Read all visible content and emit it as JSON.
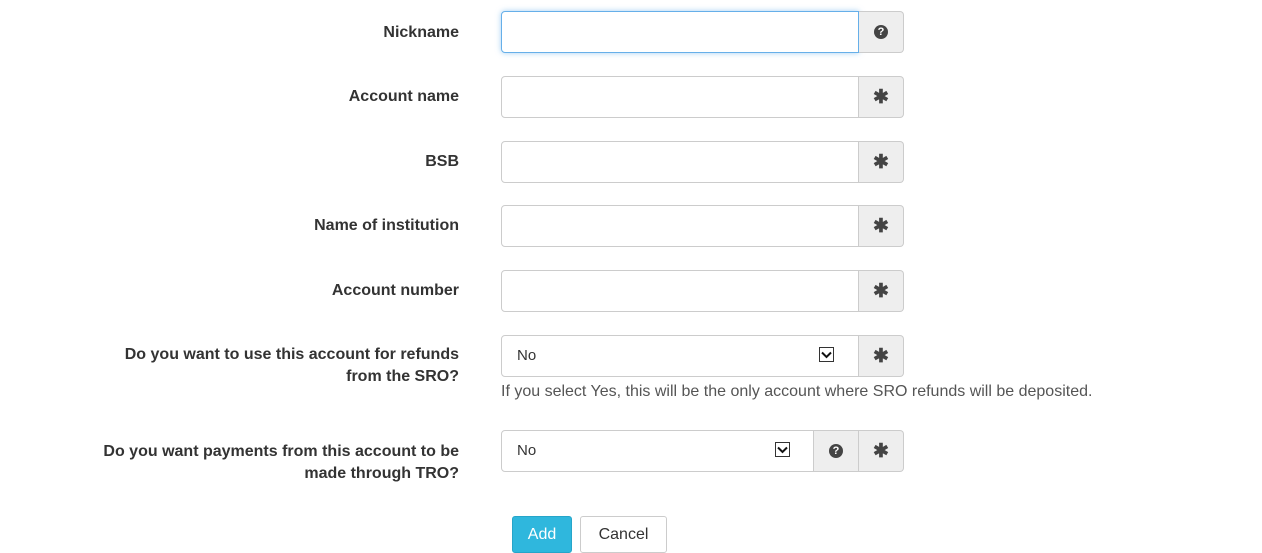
{
  "fields": {
    "nickname": {
      "label": "Nickname",
      "value": ""
    },
    "account_name": {
      "label": "Account name",
      "value": ""
    },
    "bsb": {
      "label": "BSB",
      "value": ""
    },
    "institution": {
      "label": "Name of institution",
      "value": ""
    },
    "account_number": {
      "label": "Account number",
      "value": ""
    },
    "refunds": {
      "label_line1": "Do you want to use this account for refunds",
      "label_line2": "from the SRO?",
      "value": "No",
      "hint": "If you select Yes, this will be the only account where SRO refunds will be deposited."
    },
    "payments": {
      "label_line1": "Do you want payments from this account to be",
      "label_line2": "made through TRO?",
      "value": "No"
    }
  },
  "icons": {
    "required": "asterisk-icon",
    "help": "question-circle-icon",
    "dropdown": "chevron-down-icon"
  },
  "glyphs": {
    "required": "✱",
    "help": "?"
  },
  "buttons": {
    "add": "Add",
    "cancel": "Cancel"
  },
  "colors": {
    "primary": "#2fb7dd",
    "addon_bg": "#eeeeee",
    "border": "#cccccc",
    "focus": "#66afe9"
  }
}
